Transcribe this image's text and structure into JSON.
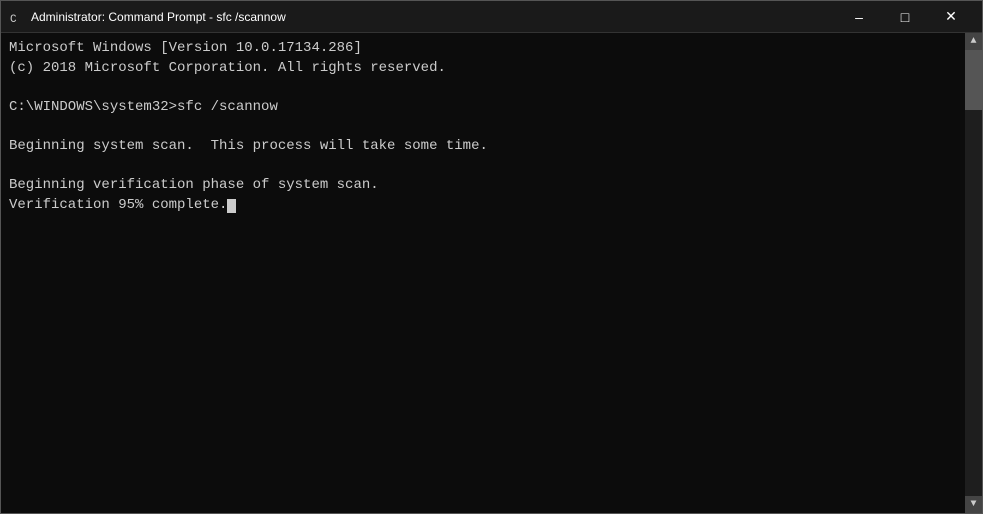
{
  "titlebar": {
    "icon_label": "command-prompt-icon",
    "title": "Administrator: Command Prompt - sfc /scannow",
    "minimize_label": "–",
    "maximize_label": "□",
    "close_label": "✕"
  },
  "terminal": {
    "lines": [
      "Microsoft Windows [Version 10.0.17134.286]",
      "(c) 2018 Microsoft Corporation. All rights reserved.",
      "",
      "C:\\WINDOWS\\system32>sfc /scannow",
      "",
      "Beginning system scan.  This process will take some time.",
      "",
      "Beginning verification phase of system scan.",
      "Verification 95% complete."
    ]
  }
}
